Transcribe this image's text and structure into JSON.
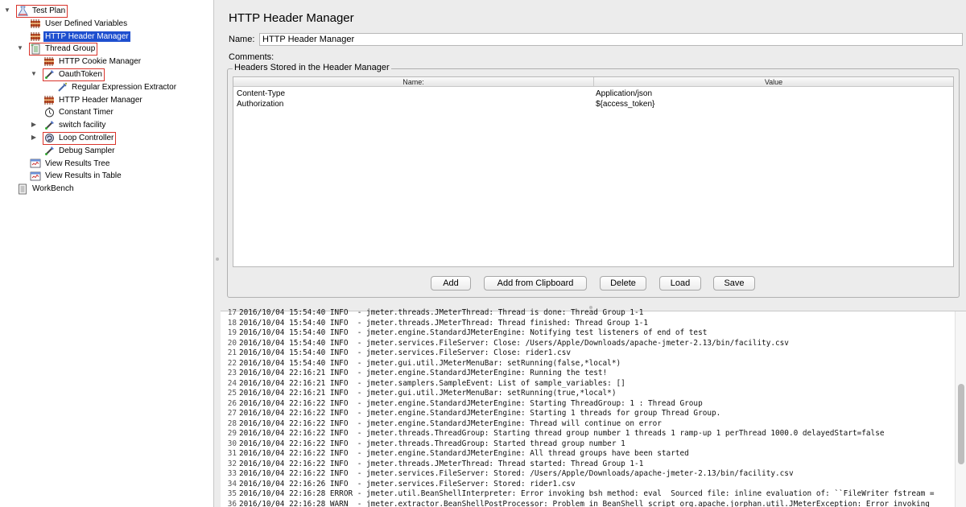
{
  "tree": {
    "nodes": [
      {
        "label": "Test Plan",
        "icon": "test-plan-icon",
        "depth": 0,
        "toggle": "▼",
        "boxed": true,
        "selected": false
      },
      {
        "label": "User Defined Variables",
        "icon": "config-element-icon",
        "depth": 1,
        "toggle": "",
        "boxed": false,
        "selected": false
      },
      {
        "label": "HTTP Header Manager",
        "icon": "config-element-icon",
        "depth": 1,
        "toggle": "",
        "boxed": false,
        "selected": true
      },
      {
        "label": "Thread Group",
        "icon": "thread-group-icon",
        "depth": 1,
        "toggle": "▼",
        "boxed": true,
        "selected": false
      },
      {
        "label": "HTTP Cookie Manager",
        "icon": "config-element-icon",
        "depth": 2,
        "toggle": "",
        "boxed": false,
        "selected": false
      },
      {
        "label": "OauthToken",
        "icon": "sampler-icon",
        "depth": 2,
        "toggle": "▼",
        "boxed": true,
        "selected": false
      },
      {
        "label": "Regular Expression Extractor",
        "icon": "post-processor-icon",
        "depth": 3,
        "toggle": "",
        "boxed": false,
        "selected": false
      },
      {
        "label": "HTTP Header Manager",
        "icon": "config-element-icon",
        "depth": 2,
        "toggle": "",
        "boxed": false,
        "selected": false
      },
      {
        "label": "Constant Timer",
        "icon": "timer-icon",
        "depth": 2,
        "toggle": "",
        "boxed": false,
        "selected": false
      },
      {
        "label": "switch facility",
        "icon": "sampler-icon",
        "depth": 2,
        "toggle": "▶",
        "boxed": false,
        "selected": false
      },
      {
        "label": "Loop Controller",
        "icon": "loop-controller-icon",
        "depth": 2,
        "toggle": "▶",
        "boxed": true,
        "selected": false
      },
      {
        "label": "Debug Sampler",
        "icon": "sampler-icon",
        "depth": 2,
        "toggle": "",
        "boxed": false,
        "selected": false
      },
      {
        "label": "View Results Tree",
        "icon": "listener-icon",
        "depth": 1,
        "toggle": "",
        "boxed": false,
        "selected": false
      },
      {
        "label": "View Results in Table",
        "icon": "listener-icon",
        "depth": 1,
        "toggle": "",
        "boxed": false,
        "selected": false
      },
      {
        "label": "WorkBench",
        "icon": "workbench-icon",
        "depth": 0,
        "toggle": "",
        "boxed": false,
        "selected": false
      }
    ]
  },
  "panel": {
    "title": "HTTP Header Manager",
    "name_label": "Name:",
    "name_value": "HTTP Header Manager",
    "comments_label": "Comments:",
    "comments_value": "",
    "group_title": "Headers Stored in the Header Manager",
    "columns": {
      "name": "Name:",
      "value": "Value"
    },
    "headers": [
      {
        "name": "Content-Type",
        "value": "Application/json"
      },
      {
        "name": "Authorization",
        "value": "${access_token}"
      }
    ],
    "buttons": {
      "add": "Add",
      "add_from_clipboard": "Add from Clipboard",
      "delete": "Delete",
      "load": "Load",
      "save": "Save"
    }
  },
  "log": {
    "lines": [
      {
        "n": "17",
        "text": "2016/10/04 15:54:40 INFO  - jmeter.threads.JMeterThread: Thread is done: Thread Group 1-1"
      },
      {
        "n": "18",
        "text": "2016/10/04 15:54:40 INFO  - jmeter.threads.JMeterThread: Thread finished: Thread Group 1-1"
      },
      {
        "n": "19",
        "text": "2016/10/04 15:54:40 INFO  - jmeter.engine.StandardJMeterEngine: Notifying test listeners of end of test"
      },
      {
        "n": "20",
        "text": "2016/10/04 15:54:40 INFO  - jmeter.services.FileServer: Close: /Users/Apple/Downloads/apache-jmeter-2.13/bin/facility.csv"
      },
      {
        "n": "21",
        "text": "2016/10/04 15:54:40 INFO  - jmeter.services.FileServer: Close: rider1.csv"
      },
      {
        "n": "22",
        "text": "2016/10/04 15:54:40 INFO  - jmeter.gui.util.JMeterMenuBar: setRunning(false,*local*)"
      },
      {
        "n": "23",
        "text": "2016/10/04 22:16:21 INFO  - jmeter.engine.StandardJMeterEngine: Running the test!"
      },
      {
        "n": "24",
        "text": "2016/10/04 22:16:21 INFO  - jmeter.samplers.SampleEvent: List of sample_variables: []"
      },
      {
        "n": "25",
        "text": "2016/10/04 22:16:21 INFO  - jmeter.gui.util.JMeterMenuBar: setRunning(true,*local*)"
      },
      {
        "n": "26",
        "text": "2016/10/04 22:16:22 INFO  - jmeter.engine.StandardJMeterEngine: Starting ThreadGroup: 1 : Thread Group"
      },
      {
        "n": "27",
        "text": "2016/10/04 22:16:22 INFO  - jmeter.engine.StandardJMeterEngine: Starting 1 threads for group Thread Group."
      },
      {
        "n": "28",
        "text": "2016/10/04 22:16:22 INFO  - jmeter.engine.StandardJMeterEngine: Thread will continue on error"
      },
      {
        "n": "29",
        "text": "2016/10/04 22:16:22 INFO  - jmeter.threads.ThreadGroup: Starting thread group number 1 threads 1 ramp-up 1 perThread 1000.0 delayedStart=false"
      },
      {
        "n": "30",
        "text": "2016/10/04 22:16:22 INFO  - jmeter.threads.ThreadGroup: Started thread group number 1"
      },
      {
        "n": "31",
        "text": "2016/10/04 22:16:22 INFO  - jmeter.engine.StandardJMeterEngine: All thread groups have been started"
      },
      {
        "n": "32",
        "text": "2016/10/04 22:16:22 INFO  - jmeter.threads.JMeterThread: Thread started: Thread Group 1-1"
      },
      {
        "n": "33",
        "text": "2016/10/04 22:16:22 INFO  - jmeter.services.FileServer: Stored: /Users/Apple/Downloads/apache-jmeter-2.13/bin/facility.csv"
      },
      {
        "n": "34",
        "text": "2016/10/04 22:16:26 INFO  - jmeter.services.FileServer: Stored: rider1.csv"
      },
      {
        "n": "35",
        "text": "2016/10/04 22:16:28 ERROR - jmeter.util.BeanShellInterpreter: Error invoking bsh method: eval  Sourced file: inline evaluation of: ``FileWriter fstream ="
      },
      {
        "n": "36",
        "text": "2016/10/04 22:16:28 WARN  - jmeter.extractor.BeanShellPostProcessor: Problem in BeanShell script org.apache.jorphan.util.JMeterException: Error invoking"
      }
    ]
  }
}
